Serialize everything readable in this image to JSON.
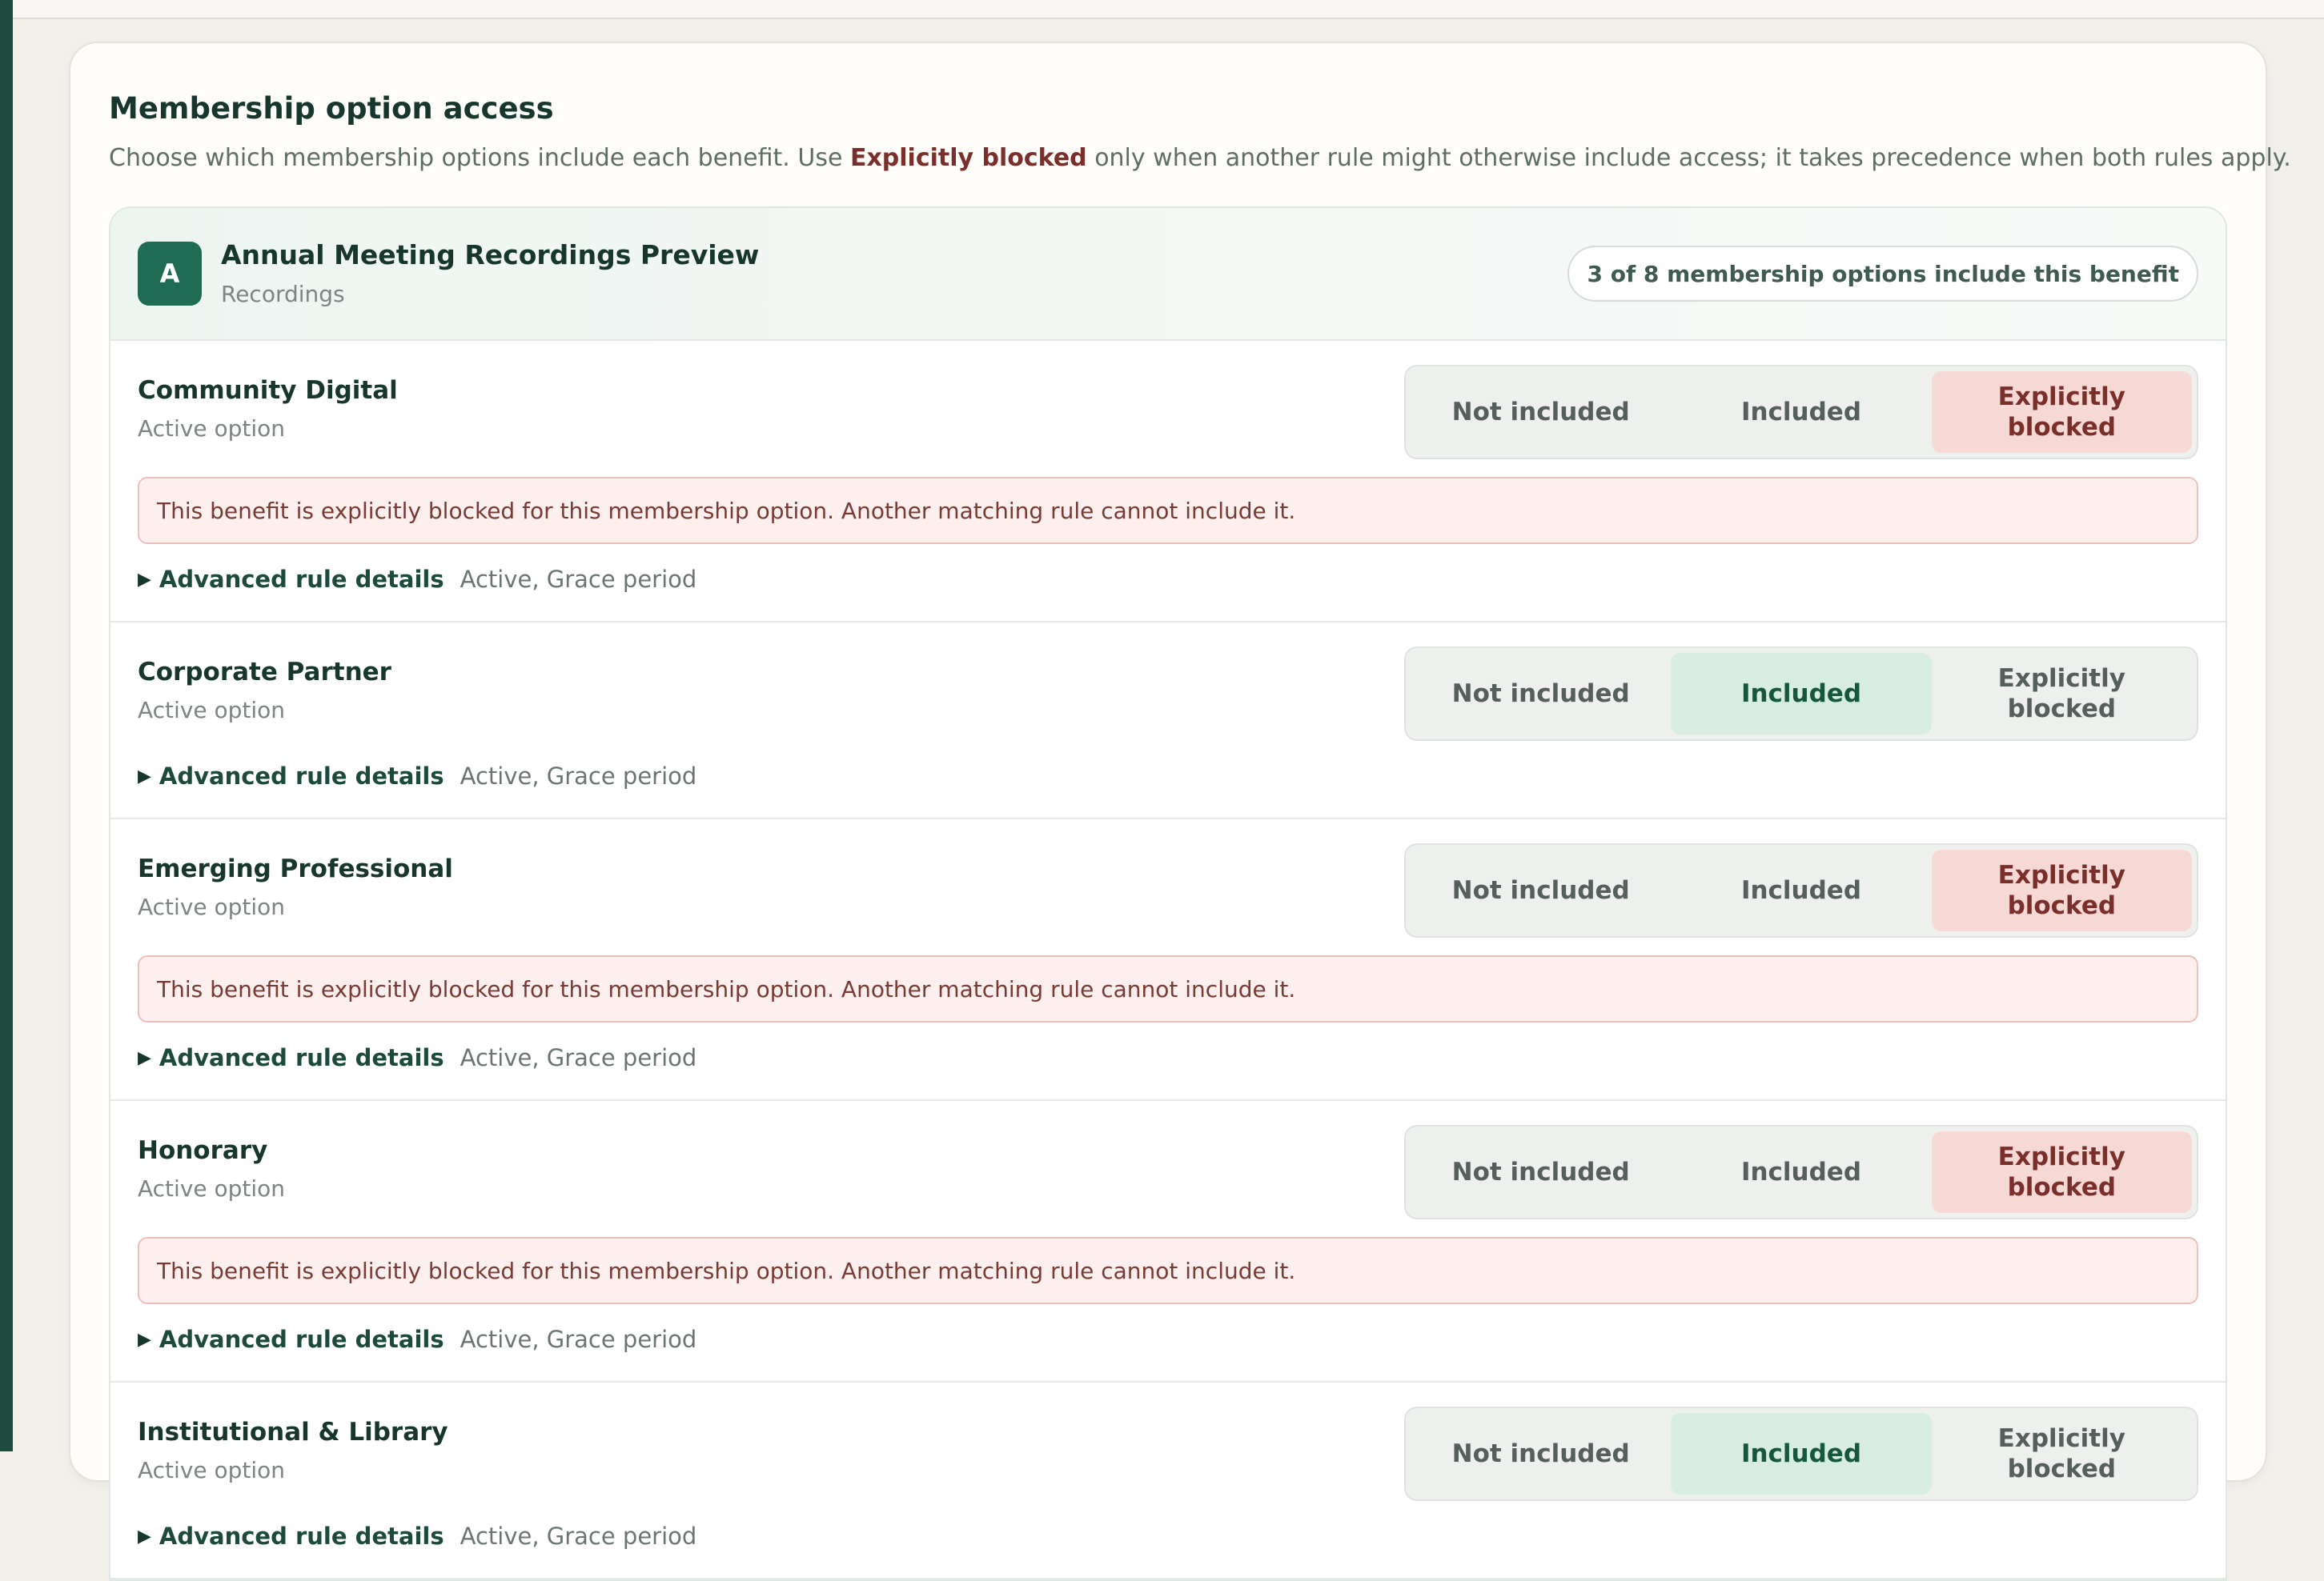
{
  "section": {
    "title": "Membership option access",
    "desc_before": "Choose which membership options include each benefit. Use ",
    "desc_strong": "Explicitly blocked",
    "desc_after": " only when another rule might otherwise include access; it takes precedence when both rules apply."
  },
  "benefit": {
    "avatar_letter": "A",
    "name": "Annual Meeting Recordings Preview",
    "category": "Recordings",
    "count_label": "3 of 8 membership options include this benefit"
  },
  "segment_labels": {
    "not_included": "Not included",
    "included": "Included",
    "blocked": "Explicitly blocked"
  },
  "blocked_message": "This benefit is explicitly blocked for this membership option. Another matching rule cannot include it.",
  "advanced_label": "Advanced rule details",
  "options": [
    {
      "name": "Community Digital",
      "status": "Active option",
      "state": "blocked",
      "rule_details": "Active, Grace period"
    },
    {
      "name": "Corporate Partner",
      "status": "Active option",
      "state": "included",
      "rule_details": "Active, Grace period"
    },
    {
      "name": "Emerging Professional",
      "status": "Active option",
      "state": "blocked",
      "rule_details": "Active, Grace period"
    },
    {
      "name": "Honorary",
      "status": "Active option",
      "state": "blocked",
      "rule_details": "Active, Grace period"
    },
    {
      "name": "Institutional & Library",
      "status": "Active option",
      "state": "included",
      "rule_details": "Active, Grace period"
    }
  ],
  "colors": {
    "brand": "#1f6b54",
    "included_bg": "#d7ede2",
    "blocked_bg": "#f6d9d4",
    "blocked_text": "#7a2f2a"
  }
}
